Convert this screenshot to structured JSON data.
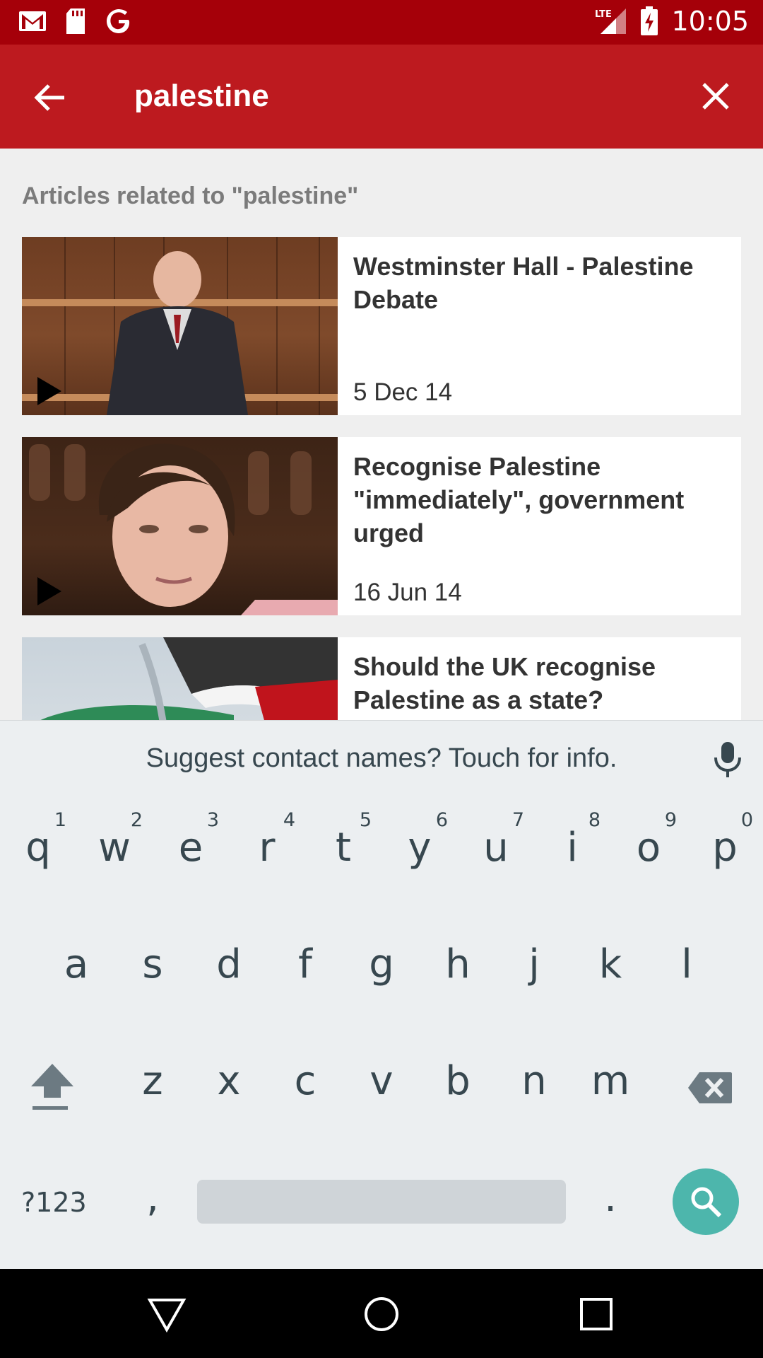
{
  "status_bar": {
    "time": "10:05",
    "network": "LTE",
    "left_icons": [
      "gmail-icon",
      "sd-card-icon",
      "google-icon"
    ]
  },
  "app_bar": {
    "search_value": "palestine",
    "back_icon": "back-arrow-icon",
    "close_icon": "close-icon"
  },
  "results": {
    "section_title": "Articles related to \"palestine\"",
    "items": [
      {
        "title": "Westminster Hall - Palestine Debate",
        "date": "5 Dec 14",
        "has_video": true
      },
      {
        "title": "Recognise Palestine \"immediately\", government urged",
        "date": "16 Jun 14",
        "has_video": true
      },
      {
        "title": "Should the UK recognise Palestine as a state?",
        "date": "",
        "has_video": false
      }
    ]
  },
  "suggest_bar": {
    "text": "Suggest contact names? Touch for info.",
    "icon": "mic-icon"
  },
  "keyboard": {
    "row1": [
      {
        "ch": "q",
        "num": "1"
      },
      {
        "ch": "w",
        "num": "2"
      },
      {
        "ch": "e",
        "num": "3"
      },
      {
        "ch": "r",
        "num": "4"
      },
      {
        "ch": "t",
        "num": "5"
      },
      {
        "ch": "y",
        "num": "6"
      },
      {
        "ch": "u",
        "num": "7"
      },
      {
        "ch": "i",
        "num": "8"
      },
      {
        "ch": "o",
        "num": "9"
      },
      {
        "ch": "p",
        "num": "0"
      }
    ],
    "row2": [
      "a",
      "s",
      "d",
      "f",
      "g",
      "h",
      "j",
      "k",
      "l"
    ],
    "row3": [
      "z",
      "x",
      "c",
      "v",
      "b",
      "n",
      "m"
    ],
    "symbols_label": "?123",
    "comma": ",",
    "period": "."
  },
  "colors": {
    "status_bar": "#a50009",
    "app_bar": "#bd1a1f",
    "search_key": "#4db6ac"
  }
}
